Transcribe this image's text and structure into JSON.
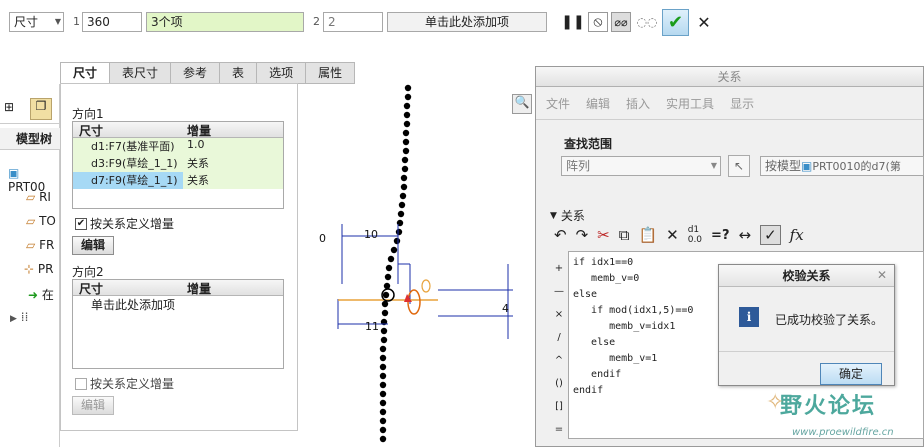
{
  "toolbar": {
    "type_select": "尺寸",
    "slot1_num": "1",
    "slot1_value": "360",
    "slot1_items": "3个项",
    "slot2_num": "2",
    "slot2_value": "2",
    "slot2_items": "单击此处添加项"
  },
  "tabs": [
    "尺寸",
    "表尺寸",
    "参考",
    "表",
    "选项",
    "属性"
  ],
  "dir1": {
    "title": "方向1",
    "col_dim": "尺寸",
    "col_inc": "增量",
    "rows": [
      {
        "dim": "d1:F7(基准平面)",
        "inc": "1.0"
      },
      {
        "dim": "d3:F9(草绘_1_1)",
        "inc": "关系"
      },
      {
        "dim": "d7:F9(草绘_1_1)",
        "inc": "关系"
      }
    ],
    "checkbox_label": "按关系定义增量",
    "edit_label": "编辑"
  },
  "dir2": {
    "title": "方向2",
    "col_dim": "尺寸",
    "col_inc": "增量",
    "add_item": "单击此处添加项",
    "checkbox_label": "按关系定义增量",
    "edit_label": "编辑"
  },
  "tree": {
    "title": "模型树",
    "items": [
      "PRT00",
      "RI",
      "TO",
      "FR",
      "PR",
      "在"
    ]
  },
  "sketch": {
    "dims": [
      "0",
      "10",
      "11",
      "4"
    ]
  },
  "relations": {
    "window_title": "关系",
    "menu": [
      "文件",
      "编辑",
      "插入",
      "实用工具",
      "显示"
    ],
    "scope_label": "查找范围",
    "scope_value": "阵列",
    "model_value": "按模型",
    "model_ref": "PRT0010的d7(第",
    "section_label": "关系",
    "code": "if idx1==0\n   memb_v=0\nelse\n   if mod(idx1,5)==0\n      memb_v=idx1\n   else\n      memb_v=1\n   endif\nendif",
    "side_ops": [
      "+",
      "—",
      "×",
      "/",
      "^",
      "()",
      "[]",
      "="
    ]
  },
  "verify": {
    "title": "校验关系",
    "message": "已成功校验了关系。",
    "ok": "确定"
  },
  "watermark": {
    "text": "野火论坛",
    "url": "www.proewildfire.cn"
  }
}
